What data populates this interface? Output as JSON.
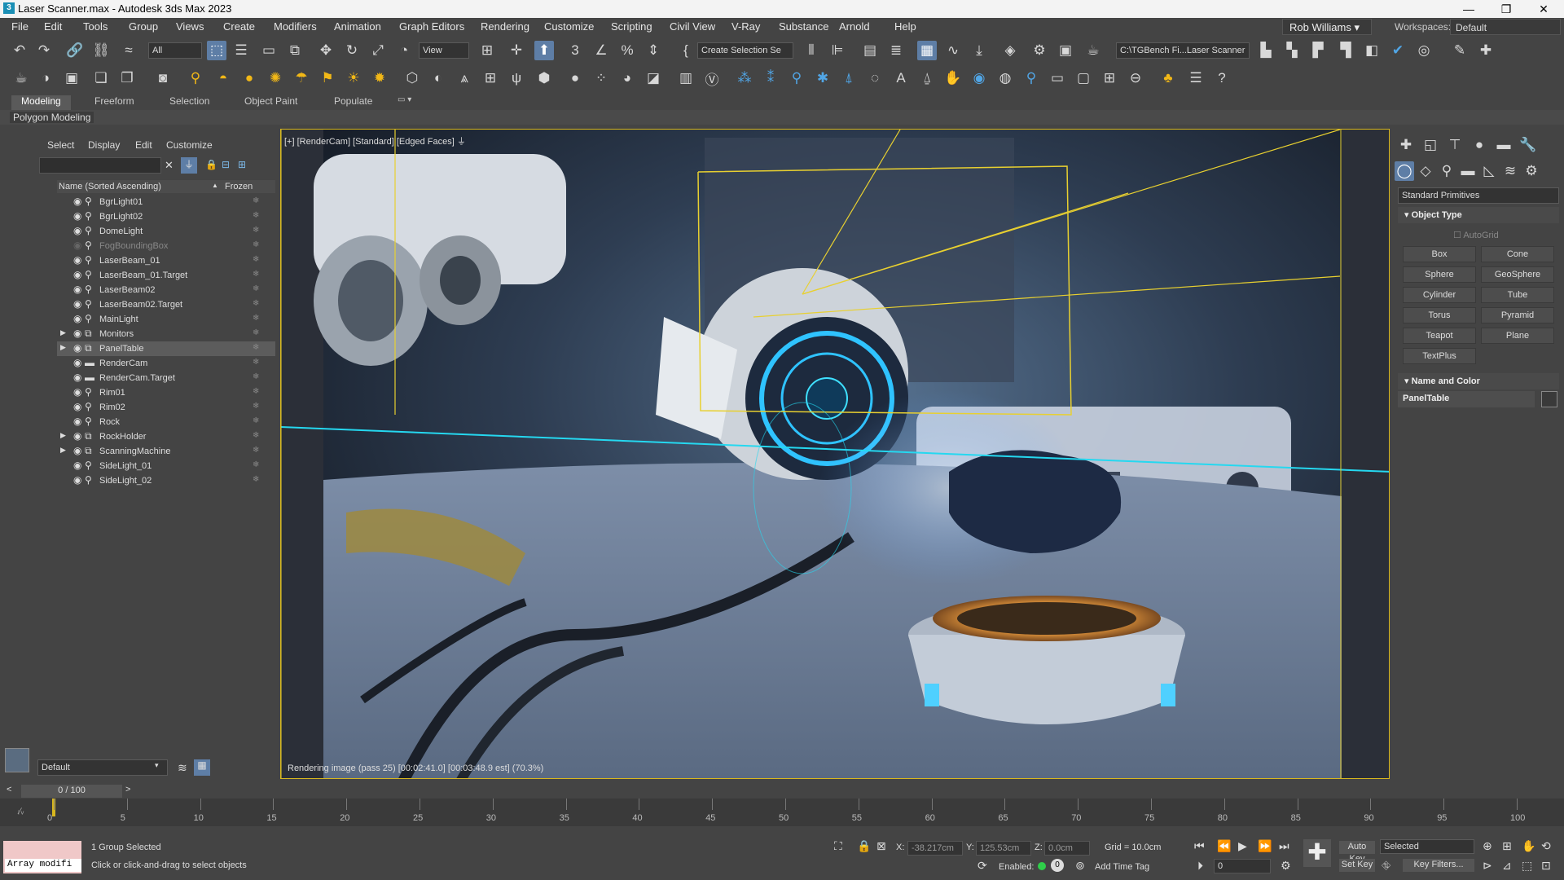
{
  "app": {
    "title": "Laser Scanner.max - Autodesk 3ds Max 2023"
  },
  "window_controls": {
    "minimize": "—",
    "maximize": "❐",
    "close": "✕"
  },
  "menu": [
    "File",
    "Edit",
    "Tools",
    "Group",
    "Views",
    "Create",
    "Modifiers",
    "Animation",
    "Graph Editors",
    "Rendering",
    "Customize",
    "Scripting",
    "Civil View",
    "V-Ray",
    "Substance",
    "Arnold",
    "Help"
  ],
  "user": {
    "name": "Rob Williams",
    "workspace_label": "Workspaces:",
    "workspace": "Default"
  },
  "toolbar1": {
    "filter": "All",
    "view": "View",
    "selection_set": "Create Selection Se",
    "path": "C:\\TGBench Fi...Laser Scanner"
  },
  "ribbon": {
    "tabs": [
      "Modeling",
      "Freeform",
      "Selection",
      "Object Paint",
      "Populate"
    ],
    "active": "Modeling",
    "sub": "Polygon Modeling"
  },
  "scene_explorer": {
    "tabs": [
      "Select",
      "Display",
      "Edit",
      "Customize"
    ],
    "col_name": "Name (Sorted Ascending)",
    "col_frozen": "Frozen",
    "items": [
      {
        "name": "BgrLight01",
        "type": "light"
      },
      {
        "name": "BgrLight02",
        "type": "light"
      },
      {
        "name": "DomeLight",
        "type": "light"
      },
      {
        "name": "FogBoundingBox",
        "type": "light",
        "dim": true
      },
      {
        "name": "LaserBeam_01",
        "type": "light"
      },
      {
        "name": "LaserBeam_01.Target",
        "type": "light"
      },
      {
        "name": "LaserBeam02",
        "type": "light"
      },
      {
        "name": "LaserBeam02.Target",
        "type": "light"
      },
      {
        "name": "MainLight",
        "type": "light"
      },
      {
        "name": "Monitors",
        "type": "group",
        "expand": true
      },
      {
        "name": "PanelTable",
        "type": "group",
        "expand": true,
        "selected": true
      },
      {
        "name": "RenderCam",
        "type": "camera"
      },
      {
        "name": "RenderCam.Target",
        "type": "camera"
      },
      {
        "name": "Rim01",
        "type": "light"
      },
      {
        "name": "Rim02",
        "type": "light"
      },
      {
        "name": "Rock",
        "type": "light"
      },
      {
        "name": "RockHolder",
        "type": "group",
        "expand": true
      },
      {
        "name": "ScanningMachine",
        "type": "group",
        "expand": true
      },
      {
        "name": "SideLight_01",
        "type": "light"
      },
      {
        "name": "SideLight_02",
        "type": "light"
      }
    ],
    "layer": "Default"
  },
  "viewport": {
    "label": "[+] [RenderCam] [Standard] [Edged Faces]",
    "render_status": "Rendering image (pass 25) [00:02:41.0] [00:03:48.9 est]  (70.3%)"
  },
  "command_panel": {
    "category": "Standard Primitives",
    "object_type": "Object Type",
    "autogrid": "AutoGrid",
    "buttons": [
      "Box",
      "Cone",
      "Sphere",
      "GeoSphere",
      "Cylinder",
      "Tube",
      "Torus",
      "Pyramid",
      "Teapot",
      "Plane",
      "TextPlus"
    ],
    "name_color": "Name and Color",
    "object_name": "PanelTable"
  },
  "timeline": {
    "frame": "0 / 100",
    "ticks": [
      "0",
      "5",
      "10",
      "15",
      "20",
      "25",
      "30",
      "35",
      "40",
      "45",
      "50",
      "55",
      "60",
      "65",
      "70",
      "75",
      "80",
      "85",
      "90",
      "95",
      "100"
    ]
  },
  "status": {
    "selection": "1 Group Selected",
    "prompt": "Click or click-and-drag to select objects",
    "maxscript": "Array modifi",
    "x": "-38.217cm",
    "y": "125.53cm",
    "z": "0.0cm",
    "grid": "Grid = 10.0cm",
    "enabled": "Enabled:",
    "add_time_tag": "Add Time Tag",
    "auto_key": "Auto Key",
    "set_key": "Set Key",
    "key_mode": "Selected",
    "key_filters": "Key Filters...",
    "frame_field": "0"
  }
}
